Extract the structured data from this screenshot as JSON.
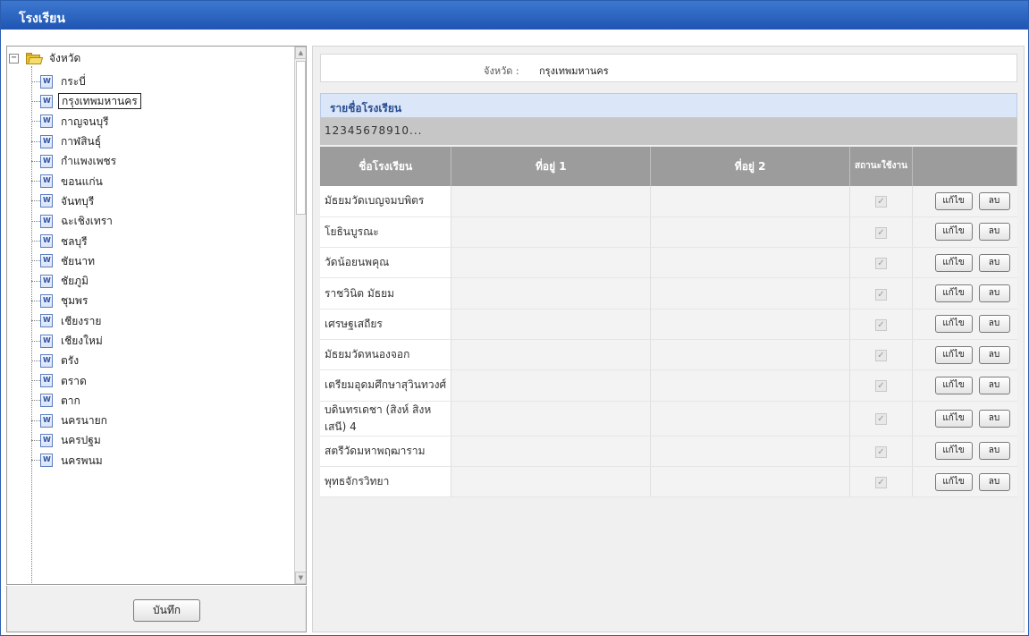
{
  "window": {
    "title": "โรงเรียน"
  },
  "tree": {
    "root_label": "จังหวัด",
    "items": [
      {
        "label": "กระบี่",
        "selected": false
      },
      {
        "label": "กรุงเทพมหานคร",
        "selected": true
      },
      {
        "label": "กาญจนบุรี",
        "selected": false
      },
      {
        "label": "กาฬสินธุ์",
        "selected": false
      },
      {
        "label": "กำแพงเพชร",
        "selected": false
      },
      {
        "label": "ขอนแก่น",
        "selected": false
      },
      {
        "label": "จันทบุรี",
        "selected": false
      },
      {
        "label": "ฉะเชิงเทรา",
        "selected": false
      },
      {
        "label": "ชลบุรี",
        "selected": false
      },
      {
        "label": "ชัยนาท",
        "selected": false
      },
      {
        "label": "ชัยภูมิ",
        "selected": false
      },
      {
        "label": "ชุมพร",
        "selected": false
      },
      {
        "label": "เชียงราย",
        "selected": false
      },
      {
        "label": "เชียงใหม่",
        "selected": false
      },
      {
        "label": "ตรัง",
        "selected": false
      },
      {
        "label": "ตราด",
        "selected": false
      },
      {
        "label": "ตาก",
        "selected": false
      },
      {
        "label": "นครนายก",
        "selected": false
      },
      {
        "label": "นครปฐม",
        "selected": false
      },
      {
        "label": "นครพนม",
        "selected": false
      }
    ]
  },
  "save_label": "บันทึก",
  "province": {
    "label": "จังหวัด :",
    "value": "กรุงเทพมหานคร"
  },
  "section_title": "รายชื่อโรงเรียน",
  "pager": {
    "pages": [
      "1",
      "2",
      "3",
      "4",
      "5",
      "6",
      "7",
      "8",
      "9",
      "10"
    ],
    "more": "..."
  },
  "table": {
    "headers": {
      "name": "ชื่อโรงเรียน",
      "address1": "ที่อยู่ 1",
      "address2": "ที่อยู่ 2",
      "status": "สถานะใช้งาน"
    },
    "edit_label": "แก้ไข",
    "delete_label": "ลบ",
    "rows": [
      {
        "name": "มัธยมวัดเบญจมบพิตร",
        "address1": "",
        "address2": "",
        "active": true
      },
      {
        "name": "โยธินบูรณะ",
        "address1": "",
        "address2": "",
        "active": true
      },
      {
        "name": "วัดน้อยนพคุณ",
        "address1": "",
        "address2": "",
        "active": true
      },
      {
        "name": "ราชวินิต มัธยม",
        "address1": "",
        "address2": "",
        "active": true
      },
      {
        "name": "เศรษฐเสถียร",
        "address1": "",
        "address2": "",
        "active": true
      },
      {
        "name": "มัธยมวัดหนองจอก",
        "address1": "",
        "address2": "",
        "active": true
      },
      {
        "name": "เตรียมอุดมศึกษาสุวินทวงศ์",
        "address1": "",
        "address2": "",
        "active": true
      },
      {
        "name": "บดินทรเดชา (สิงห์ สิงหเสนี) 4",
        "address1": "",
        "address2": "",
        "active": true
      },
      {
        "name": "สตรีวัดมหาพฤฒาราม",
        "address1": "",
        "address2": "",
        "active": true
      },
      {
        "name": "พุทธจักรวิทยา",
        "address1": "",
        "address2": "",
        "active": true
      }
    ]
  }
}
